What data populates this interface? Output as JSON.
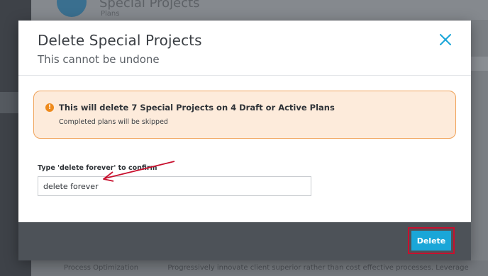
{
  "background": {
    "title": "Special Projects",
    "subtitle": "Plans",
    "footer_col1": "Process Optimization",
    "footer_col2": "Progressively innovate client superior rather than cost effective processes. Leverage"
  },
  "modal": {
    "title": "Delete Special Projects",
    "subtitle": "This cannot be undone",
    "close_icon": "close-icon"
  },
  "warning": {
    "icon": "exclamation-icon",
    "title": "This will delete 7 Special Projects on 4 Draft or Active Plans",
    "text": "Completed plans will be skipped"
  },
  "confirm": {
    "label": "Type 'delete forever' to confirm",
    "value": "delete forever"
  },
  "footer": {
    "delete_label": "Delete"
  },
  "colors": {
    "accent": "#1aa6d8",
    "warning_border": "#f0a35a",
    "warning_bg": "#fdebdb",
    "annotation": "#c8102e"
  }
}
